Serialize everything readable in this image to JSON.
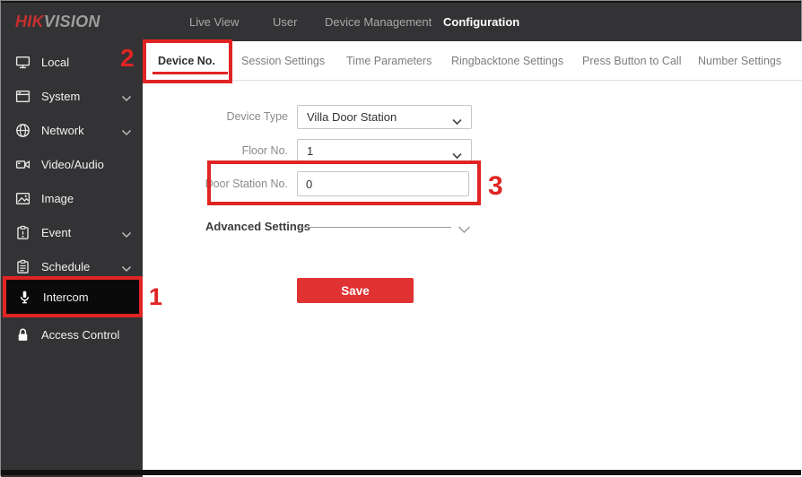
{
  "logo": {
    "hik": "HIK",
    "vision": "VISION"
  },
  "top_nav": {
    "items": [
      {
        "label": "Live View",
        "active": false
      },
      {
        "label": "User",
        "active": false
      },
      {
        "label": "Device Management",
        "active": false
      },
      {
        "label": "Configuration",
        "active": true
      }
    ]
  },
  "sidebar": {
    "items": [
      {
        "label": "Local",
        "icon": "monitor-icon",
        "expandable": false
      },
      {
        "label": "System",
        "icon": "system-window-icon",
        "expandable": true
      },
      {
        "label": "Network",
        "icon": "globe-icon",
        "expandable": true
      },
      {
        "label": "Video/Audio",
        "icon": "video-camera-icon",
        "expandable": false
      },
      {
        "label": "Image",
        "icon": "image-icon",
        "expandable": false
      },
      {
        "label": "Event",
        "icon": "event-clipboard-icon",
        "expandable": true
      },
      {
        "label": "Schedule",
        "icon": "schedule-clipboard-icon",
        "expandable": true
      },
      {
        "label": "Intercom",
        "icon": "microphone-icon",
        "expandable": false,
        "selected": true
      },
      {
        "label": "Access Control",
        "icon": "padlock-icon",
        "expandable": false
      }
    ]
  },
  "tabs": {
    "items": [
      "Device No.",
      "Session Settings",
      "Time Parameters",
      "Ringbacktone Settings",
      "Press Button to Call",
      "Number Settings"
    ],
    "active": "Device No."
  },
  "form": {
    "device_type": {
      "label": "Device Type",
      "value": "Villa Door Station"
    },
    "floor_no": {
      "label": "Floor No.",
      "value": "1"
    },
    "door_station_no": {
      "label": "Door Station No.",
      "value": "0"
    },
    "advanced_settings_label": "Advanced Settings",
    "save_label": "Save"
  },
  "annotations": {
    "step1": "1",
    "step2": "2",
    "step3": "3"
  },
  "colors": {
    "annotation_red": "#e02424",
    "save_red": "#e03232",
    "active_tab_red": "#e02424",
    "topbar_bg": "#333335",
    "sidebar_bg": "#333335",
    "selected_item_bg": "#0a0a0a"
  }
}
